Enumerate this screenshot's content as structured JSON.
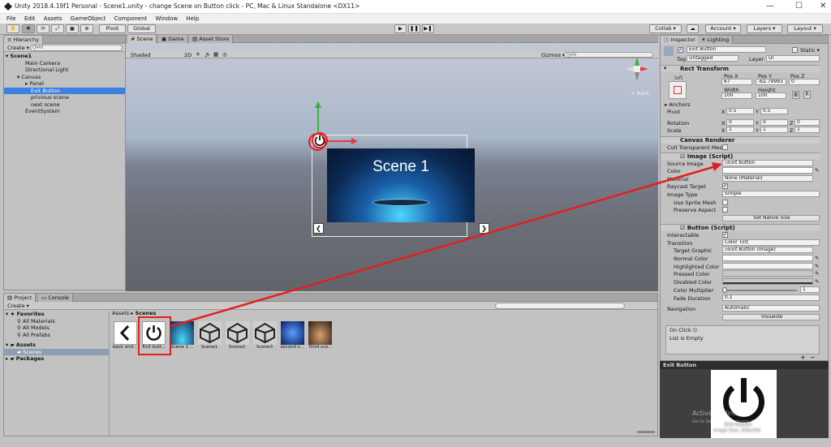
{
  "window": {
    "title": "Unity 2018.4.19f1 Personal - Scene1.unity - change Scene on Button click - PC, Mac & Linux Standalone <DX11>",
    "minimize": "—",
    "maximize": "☐",
    "close": "✕"
  },
  "menu": [
    "File",
    "Edit",
    "Assets",
    "GameObject",
    "Component",
    "Window",
    "Help"
  ],
  "toolbar": {
    "pivot": "Pivot",
    "global": "Global",
    "play": "▶",
    "pause": "❚❚",
    "step": "▶❚",
    "collab": "Collab ▾",
    "cloud": "☁",
    "account": "Account ▾",
    "layers": "Layers ▾",
    "layout": "Layout ▾"
  },
  "hierarchy": {
    "tab": "Hierarchy",
    "create": "Create ▾",
    "search_placeholder": "Q▾All",
    "items": [
      {
        "label": "Scene1",
        "indent": 0,
        "bold": true
      },
      {
        "label": "Main Camera",
        "indent": 1
      },
      {
        "label": "Directional Light",
        "indent": 1
      },
      {
        "label": "Canvas",
        "indent": 1
      },
      {
        "label": "Panel",
        "indent": 2
      },
      {
        "label": "Exit Button",
        "indent": 2,
        "selected": true
      },
      {
        "label": "privious scene",
        "indent": 2
      },
      {
        "label": "next scene",
        "indent": 2
      },
      {
        "label": "EventSystem",
        "indent": 1
      }
    ]
  },
  "scene_view": {
    "tabs": [
      "Scene",
      "Game",
      "Asset Store"
    ],
    "shaded": "Shaded",
    "mode2d": "2D",
    "gizmos": "Gizmos ▾",
    "search_placeholder": "Q▾All",
    "back_label": "< Back",
    "scene_title": "Scene 1",
    "arrow_left": "❮",
    "arrow_right": "❯"
  },
  "project": {
    "tabs": [
      "Project",
      "Console"
    ],
    "create": "Create ▾",
    "breadcrumb_root": "Assets",
    "breadcrumb_sep": "▸",
    "breadcrumb_current": "Scenes",
    "tree": [
      {
        "label": "Favorites",
        "bold": true
      },
      {
        "label": "All Materials"
      },
      {
        "label": "All Models"
      },
      {
        "label": "All Prefabs"
      },
      {
        "label": "Assets",
        "bold": true
      },
      {
        "label": "Scenes",
        "selected": true
      },
      {
        "label": "Packages",
        "bold": true
      }
    ],
    "assets": [
      "back and ...",
      "Exit butt...",
      "scene 1 ...",
      "Scene1",
      "Scene2",
      "Scene3",
      "second s...",
      "third sce..."
    ]
  },
  "inspector": {
    "tabs": [
      "Inspector",
      "Lighting"
    ],
    "object_name": "Exit Button",
    "static": "Static ▾",
    "tag_label": "Tag",
    "tag_value": "Untagged",
    "layer_label": "Layer",
    "layer_value": "UI",
    "rect": {
      "header": "Rect Transform",
      "left": "left",
      "pos_x_label": "Pos X",
      "pos_y_label": "Pos Y",
      "pos_z_label": "Pos Z",
      "pos_x": "67",
      "pos_y": "-62.79993",
      "pos_z": "0",
      "width_label": "Width",
      "height_label": "Height",
      "width": "100",
      "height": "100",
      "anchors": "Anchors",
      "pivot": "Pivot",
      "pivot_x": "0.5",
      "pivot_y": "0.5",
      "rotation": "Rotation",
      "rot_x": "0",
      "rot_y": "0",
      "rot_z": "0",
      "scale": "Scale",
      "scale_x": "1",
      "scale_y": "1",
      "scale_z": "1",
      "r_btn": "R",
      "x": "X",
      "y": "Y",
      "z": "Z"
    },
    "canvas_renderer": {
      "header": "Canvas Renderer",
      "cull": "Cull Transparent Mesh"
    },
    "image": {
      "header": "Image (Script)",
      "source_image": "Source Image",
      "source_value": "Exit button",
      "color": "Color",
      "material": "Material",
      "material_value": "None (Material)",
      "raycast": "Raycast Target",
      "image_type": "Image Type",
      "image_type_value": "Simple",
      "use_sprite_mesh": "Use Sprite Mesh",
      "preserve_aspect": "Preserve Aspect",
      "set_native": "Set Native Size"
    },
    "button": {
      "header": "Button (Script)",
      "interactable": "Interactable",
      "transition": "Transition",
      "transition_value": "Color Tint",
      "target_graphic": "Target Graphic",
      "target_value": "Exit Button (Image)",
      "normal": "Normal Color",
      "highlighted": "Highlighted Color",
      "pressed": "Pressed Color",
      "disabled": "Disabled Color",
      "multiplier": "Color Multiplier",
      "multiplier_value": "1",
      "fade": "Fade Duration",
      "fade_value": "0.1",
      "navigation": "Navigation",
      "navigation_value": "Automatic",
      "visualize": "Visualize",
      "onclick": "On Click ()",
      "list_empty": "List is Empty",
      "plus": "+",
      "minus": "−"
    },
    "preview": {
      "title": "Exit Button",
      "caption": "Exit Button",
      "size": "Image Size: 256x256",
      "watermark1": "Activate Windows",
      "watermark2": "Go to Settings to activate Windows."
    }
  },
  "colors": {
    "accent": "#3d80df",
    "annotation": "#e02020"
  }
}
